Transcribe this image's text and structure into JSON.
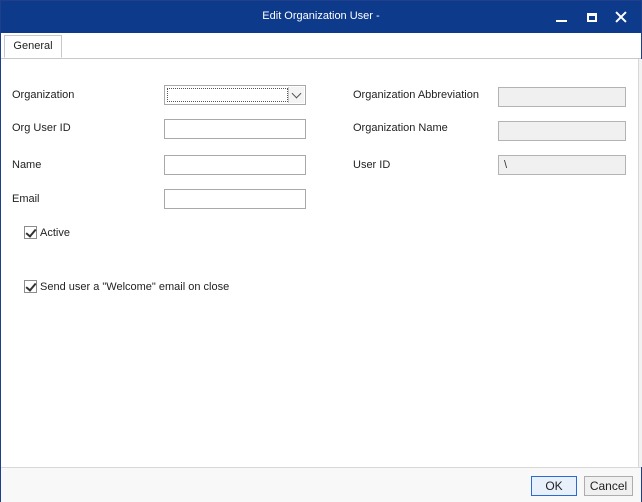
{
  "window": {
    "title": "Edit Organization User -"
  },
  "tabs": [
    {
      "label": "General"
    }
  ],
  "form": {
    "organization_label": "Organization",
    "org_user_id_label": "Org User ID",
    "name_label": "Name",
    "email_label": "Email",
    "active_label": "Active",
    "active_checked": true,
    "welcome_label": "Send user a \"Welcome\" email on close",
    "welcome_checked": true,
    "org_abbrev_label": "Organization Abbreviation",
    "org_name_label": "Organization Name",
    "user_id_label": "User ID",
    "user_id_value": "\\"
  },
  "footer": {
    "ok_label": "OK",
    "cancel_label": "Cancel"
  },
  "icons": {
    "minimize": "minimize-icon",
    "maximize": "maximize-icon",
    "close": "close-icon",
    "dropdown": "chevron-down-icon",
    "check": "checkmark-icon"
  },
  "colors": {
    "titlebar": "#0e3a8c",
    "primary_button_border": "#2b6ad0"
  }
}
